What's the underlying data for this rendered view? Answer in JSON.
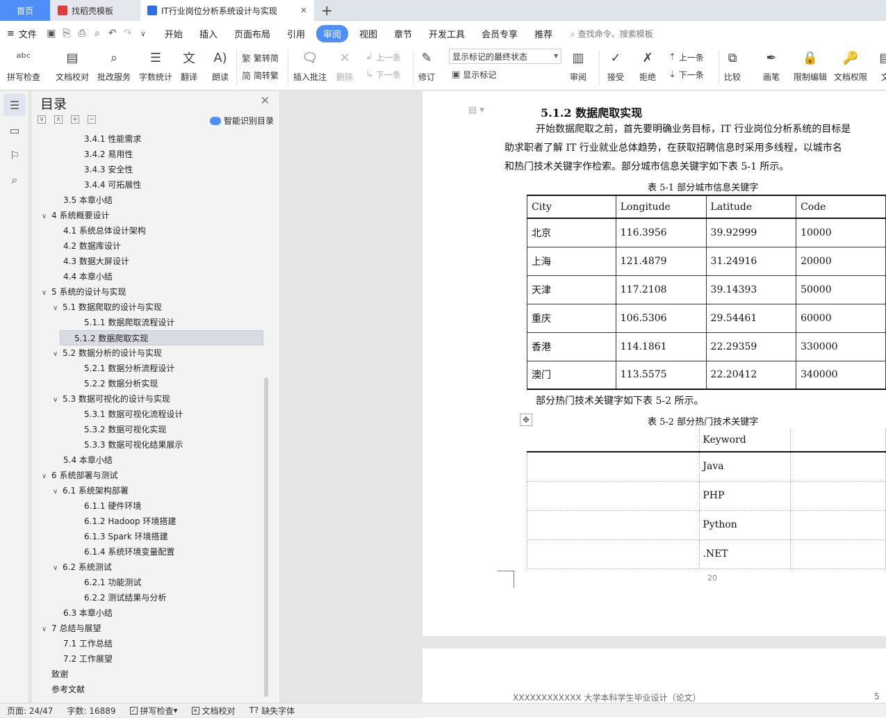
{
  "tabs": {
    "home": "首页",
    "template": "找稻壳模板",
    "doc": "IT行业岗位分析系统设计与实现"
  },
  "menubar": {
    "file": "文件",
    "items": [
      "开始",
      "插入",
      "页面布局",
      "引用",
      "审阅",
      "视图",
      "章节",
      "开发工具",
      "会员专享",
      "推荐"
    ],
    "active": "审阅",
    "search": "查找命令、搜索模板"
  },
  "ribbon": {
    "spell": "拼写检查",
    "doccheck": "文档校对",
    "review_service": "批改服务",
    "wordcount": "字数统计",
    "translate": "翻译",
    "read": "朗读",
    "t2s": "繁转简",
    "s2t": "简转繁",
    "insert_comment": "插入批注",
    "delete": "删除",
    "prev": "上一条",
    "next": "下一条",
    "track": "修订",
    "show_state": "显示标记的最终状态",
    "show_marks": "显示标记",
    "review": "审阅",
    "accept": "接受",
    "reject": "拒绝",
    "prev2": "上一条",
    "next2": "下一条",
    "compare": "比较",
    "pen": "画笔",
    "restrict": "限制编辑",
    "perm": "文档权限",
    "more": "文"
  },
  "toc": {
    "title": "目录",
    "smart": "智能识别目录",
    "items": [
      {
        "t": "3.4.1  性能需求",
        "lvl": 3,
        "arrow": ""
      },
      {
        "t": "3.4.2  易用性",
        "lvl": 3,
        "arrow": ""
      },
      {
        "t": "3.4.3  安全性",
        "lvl": 3,
        "arrow": ""
      },
      {
        "t": "3.4.4  可拓展性",
        "lvl": 3,
        "arrow": ""
      },
      {
        "t": "3.5  本章小结",
        "lvl": 2,
        "arrow": ""
      },
      {
        "t": "4  系统概要设计",
        "lvl": 1,
        "arrow": "∨"
      },
      {
        "t": "4.1  系统总体设计架构",
        "lvl": 2,
        "arrow": ""
      },
      {
        "t": "4.2  数据库设计",
        "lvl": 2,
        "arrow": ""
      },
      {
        "t": "4.3  数据大屏设计",
        "lvl": 2,
        "arrow": ""
      },
      {
        "t": "4.4  本章小结",
        "lvl": 2,
        "arrow": ""
      },
      {
        "t": "5  系统的设计与实现",
        "lvl": 1,
        "arrow": "∨"
      },
      {
        "t": "5.1  数据爬取的设计与实现",
        "lvl": 2,
        "arrow": "∨"
      },
      {
        "t": "5.1.1  数据爬取流程设计",
        "lvl": 3,
        "arrow": ""
      },
      {
        "t": "5.1.2  数据爬取实现",
        "lvl": 3,
        "arrow": "",
        "selected": true
      },
      {
        "t": "5.2  数据分析的设计与实现",
        "lvl": 2,
        "arrow": "∨"
      },
      {
        "t": "5.2.1  数据分析流程设计",
        "lvl": 3,
        "arrow": ""
      },
      {
        "t": "5.2.2  数据分析实现",
        "lvl": 3,
        "arrow": ""
      },
      {
        "t": "5.3  数据可视化的设计与实现",
        "lvl": 2,
        "arrow": "∨"
      },
      {
        "t": "5.3.1  数据可视化流程设计",
        "lvl": 3,
        "arrow": ""
      },
      {
        "t": "5.3.2  数据可视化实现",
        "lvl": 3,
        "arrow": ""
      },
      {
        "t": "5.3.3  数据可视化结果展示",
        "lvl": 3,
        "arrow": ""
      },
      {
        "t": "5.4  本章小结",
        "lvl": 2,
        "arrow": ""
      },
      {
        "t": "6  系统部署与测试",
        "lvl": 1,
        "arrow": "∨"
      },
      {
        "t": "6.1  系统架构部署",
        "lvl": 2,
        "arrow": "∨"
      },
      {
        "t": "6.1.1  硬件环境",
        "lvl": 3,
        "arrow": ""
      },
      {
        "t": "6.1.2 Hadoop 环境搭建",
        "lvl": 3,
        "arrow": ""
      },
      {
        "t": "6.1.3 Spark 环境搭建",
        "lvl": 3,
        "arrow": ""
      },
      {
        "t": "6.1.4  系统环境变量配置",
        "lvl": 3,
        "arrow": ""
      },
      {
        "t": "6.2  系统测试",
        "lvl": 2,
        "arrow": "∨"
      },
      {
        "t": "6.2.1  功能测试",
        "lvl": 3,
        "arrow": ""
      },
      {
        "t": "6.2.2  测试结果与分析",
        "lvl": 3,
        "arrow": ""
      },
      {
        "t": "6.3  本章小结",
        "lvl": 2,
        "arrow": ""
      },
      {
        "t": "7  总结与展望",
        "lvl": 1,
        "arrow": "∨"
      },
      {
        "t": "7.1  工作总结",
        "lvl": 2,
        "arrow": ""
      },
      {
        "t": "7.2  工作展望",
        "lvl": 2,
        "arrow": ""
      },
      {
        "t": "致谢",
        "lvl": 0,
        "arrow": ""
      },
      {
        "t": "参考文献",
        "lvl": 0,
        "arrow": ""
      }
    ]
  },
  "doc": {
    "heading": "5.1.2  数据爬取实现",
    "para1": "开始数据爬取之前，首先要明确业务目标，IT 行业岗位分析系统的目标是",
    "para2": "助求职者了解 IT 行业就业总体趋势，在获取招聘信息时采用多线程，以城市名",
    "para3": "和热门技术关键字作检索。部分城市信息关键字如下表 5-1 所示。",
    "cap1": "表 5-1     部分城市信息关键字",
    "table1": {
      "headers": [
        "City",
        "Longitude",
        "Latitude",
        "Code"
      ],
      "rows": [
        [
          "北京",
          "116.3956",
          "39.92999",
          "10000"
        ],
        [
          "上海",
          "121.4879",
          "31.24916",
          "20000"
        ],
        [
          "天津",
          "117.2108",
          "39.14393",
          "50000"
        ],
        [
          "重庆",
          "106.5306",
          "29.54461",
          "60000"
        ],
        [
          "香港",
          "114.1861",
          "22.29359",
          "330000"
        ],
        [
          "澳门",
          "113.5575",
          "22.20412",
          "340000"
        ]
      ]
    },
    "para4": "部分热门技术关键字如下表 5-2 所示。",
    "cap2": "表 5-2     部分热门技术关键字",
    "table2": {
      "header": "Keyword",
      "rows": [
        "Java",
        "PHP",
        "Python",
        ".NET"
      ]
    },
    "pagenum": "20",
    "footer": "XXXXXXXXXXXX 大学本科学生毕业设计（论文）",
    "footer_right": "5"
  },
  "status": {
    "page": "页面: 24/47",
    "words": "字数: 16889",
    "spell": "拼写检查",
    "doccheck": "文档校对",
    "font": "缺失字体"
  }
}
